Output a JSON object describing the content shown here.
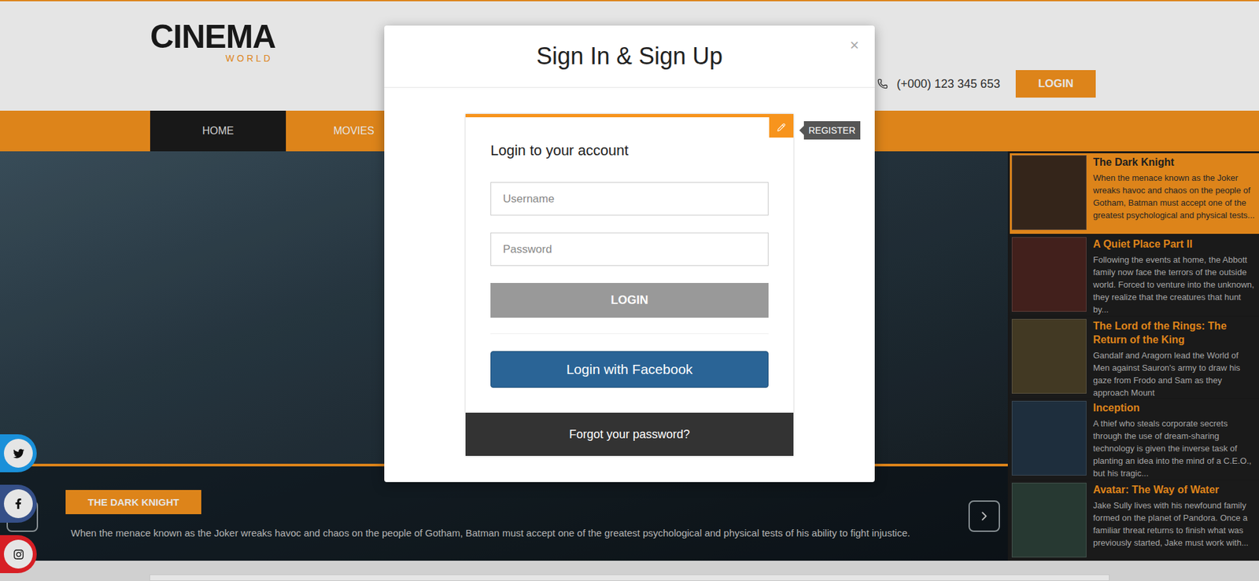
{
  "logo": {
    "title": "CINEMA",
    "subtitle": "WORLD"
  },
  "header": {
    "phone": "(+000) 123 345 653",
    "login_button": "LOGIN"
  },
  "nav": [
    {
      "label": "HOME",
      "selected": true
    },
    {
      "label": "MOVIES",
      "selected": false
    }
  ],
  "slider": {
    "caption_title": "THE DARK KNIGHT",
    "caption_text": "When the menace known as the Joker wreaks havoc and chaos on the people of Gotham, Batman must accept one of the greatest psychological and physical tests of his ability to fight injustice."
  },
  "movie_list": [
    {
      "title": "The Dark Knight",
      "description": "When the menace known as the Joker wreaks havoc and chaos on the people of Gotham, Batman must accept one of the greatest psychological and physical tests...",
      "selected": true,
      "color": "#3a2a1e"
    },
    {
      "title": "A Quiet Place Part II",
      "description": "Following the events at home, the Abbott family now face the terrors of the outside world. Forced to venture into the unknown, they realize that the creatures that hunt by...",
      "selected": false,
      "color": "#4a2420"
    },
    {
      "title": "The Lord of the Rings: The Return of the King",
      "description": "Gandalf and Aragorn lead the World of Men against Sauron's army to draw his gaze from Frodo and Sam as they approach Mount",
      "selected": false,
      "color": "#4a4028"
    },
    {
      "title": "Inception",
      "description": "A thief who steals corporate secrets through the use of dream-sharing technology is given the inverse task of planting an idea into the mind of a C.E.O., but his tragic...",
      "selected": false,
      "color": "#223444"
    },
    {
      "title": "Avatar: The Way of Water",
      "description": "Jake Sully lives with his newfound family formed on the planet of Pandora. Once a familiar threat returns to finish what was previously started, Jake must work with...",
      "selected": false,
      "color": "#2c4038"
    }
  ],
  "social": [
    {
      "kind": "twitter",
      "color": "#1da1f2"
    },
    {
      "kind": "facebook",
      "color": "#3b5998"
    },
    {
      "kind": "instagram",
      "color": "#f0232a"
    }
  ],
  "modal": {
    "title": "Sign In & Sign Up",
    "close": "×",
    "tag": "REGISTER",
    "heading": "Login to your account",
    "fields": [
      {
        "placeholder": "Username",
        "kind": "text"
      },
      {
        "placeholder": "Password",
        "kind": "password"
      }
    ],
    "login_button": "LOGIN",
    "facebook_button": "Login with Facebook",
    "forgot": "Forgot your password?"
  }
}
